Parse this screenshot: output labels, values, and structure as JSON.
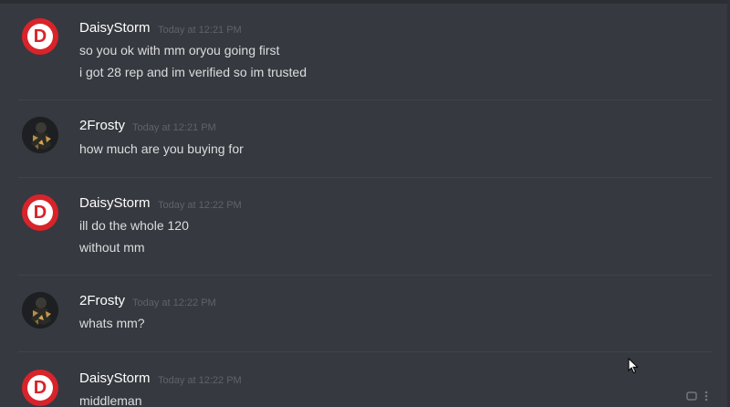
{
  "messages": [
    {
      "author": "DaisyStorm",
      "timestamp": "Today at 12:21 PM",
      "lines": [
        "so you ok with mm oryou going first",
        "i got 28 rep and im verified so im trusted"
      ],
      "avatar_icon": "red-circle-d-logo",
      "avatar_color": "#d9232a"
    },
    {
      "author": "2Frosty",
      "timestamp": "Today at 12:21 PM",
      "lines": [
        "how much are you buying for"
      ],
      "avatar_icon": "dark-figure-avatar",
      "avatar_color": "#1d1f22"
    },
    {
      "author": "DaisyStorm",
      "timestamp": "Today at 12:22 PM",
      "lines": [
        "ill do the whole 120",
        "without mm"
      ],
      "avatar_icon": "red-circle-d-logo",
      "avatar_color": "#d9232a"
    },
    {
      "author": "2Frosty",
      "timestamp": "Today at 12:22 PM",
      "lines": [
        "whats mm?"
      ],
      "avatar_icon": "dark-figure-avatar",
      "avatar_color": "#1d1f22"
    },
    {
      "author": "DaisyStorm",
      "timestamp": "Today at 12:22 PM",
      "lines": [
        "middleman"
      ],
      "avatar_icon": "red-circle-d-logo",
      "avatar_color": "#d9232a"
    }
  ],
  "colors": {
    "background": "#36393f",
    "author_name": "#ffffff",
    "timestamp": "#5f6369",
    "message_text": "#dcddde",
    "divider": "#40444b"
  },
  "icons": {
    "cursor": "mouse-pointer-icon",
    "hover_actions": "message-actions-icons"
  }
}
